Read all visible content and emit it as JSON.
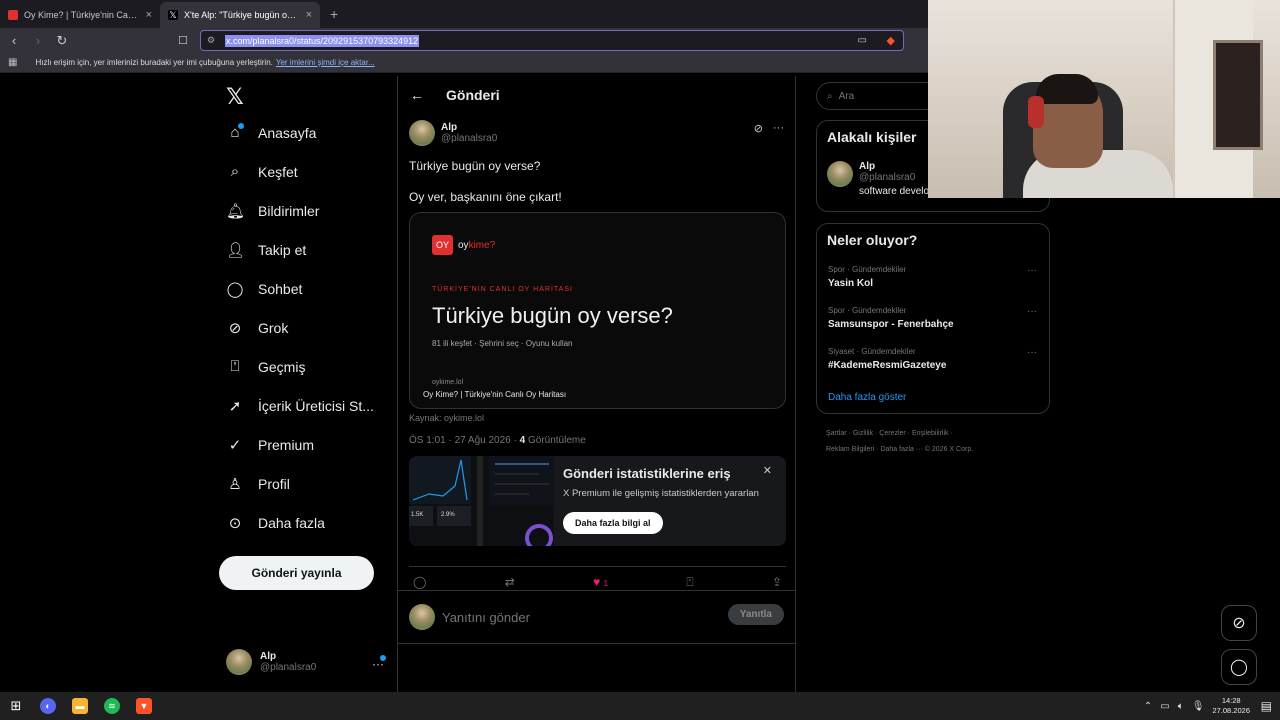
{
  "browser": {
    "tabs": [
      {
        "title": "Oy Kime? | Türkiye'nin Canlı Oy Haritası",
        "active": false
      },
      {
        "title": "X'te Alp: \"Türkiye bugün oy verse?\"",
        "active": true
      }
    ],
    "new_tab": "+",
    "url": "x.com/planalsra0/status/2092915370793324912",
    "bookmarks_bar_text": "Hızlı erişim için, yer imlerinizi buradaki yer imi çubuğuna yerleştirin.",
    "bookmarks_bar_link": "Yer imlerini şimdi içe aktar..."
  },
  "nav": {
    "items": [
      {
        "label": "Anasayfa",
        "icon": "home-icon"
      },
      {
        "label": "Keşfet",
        "icon": "search-icon"
      },
      {
        "label": "Bildirimler",
        "icon": "bell-icon"
      },
      {
        "label": "Takip et",
        "icon": "person-add-icon"
      },
      {
        "label": "Sohbet",
        "icon": "chat-icon"
      },
      {
        "label": "Grok",
        "icon": "grok-icon"
      },
      {
        "label": "Geçmiş",
        "icon": "bookmark-icon"
      },
      {
        "label": "İçerik Üreticisi St...",
        "icon": "rocket-icon"
      },
      {
        "label": "Premium",
        "icon": "verified-icon"
      },
      {
        "label": "Profil",
        "icon": "profile-icon"
      },
      {
        "label": "Daha fazla",
        "icon": "more-circle-icon"
      }
    ],
    "post_button": "Gönderi yayınla",
    "account": {
      "name": "Alp",
      "handle": "@planalsra0"
    }
  },
  "main": {
    "header": "Gönderi",
    "post": {
      "author": "Alp",
      "handle": "@planalsra0",
      "text1": "Türkiye bugün oy verse?",
      "text2": "Oy ver, başkanını öne çıkart!",
      "card": {
        "logo_box": "OY",
        "logo_oy": "oy",
        "logo_kime": "kime?",
        "eyebrow": "TÜRKİYE'NİN CANLI OY HARİTASI",
        "headline": "Türkiye bugün oy verse?",
        "sub": "81 ili keşfet · Şehrini seç · Oyunu kullan",
        "domain": "oykime.lol",
        "card_title": "Oy Kime? | Türkiye'nin Canlı Oy Haritası"
      },
      "source": "Kaynak: oykime.lol",
      "meta_time": "ÖS 1:01 · 27 Ağu 2026 · ",
      "views_count": "4",
      "views_label": " Görüntüleme",
      "promo": {
        "title": "Gönderi istatistiklerine eriş",
        "subtitle": "X Premium ile gelişmiş istatistiklerden yararlan",
        "button": "Daha fazla bilgi al",
        "stat1": "1.5K",
        "stat2": "2.9%"
      },
      "likes": "1"
    },
    "reply": {
      "placeholder": "Yanıtını gönder",
      "button": "Yanıtla"
    }
  },
  "right": {
    "search_placeholder": "Ara",
    "related_title": "Alakalı kişiler",
    "related": {
      "name": "Alp",
      "handle": "@planalsra0",
      "bio": "software developer,engineer"
    },
    "trends_title": "Neler oluyor?",
    "trends": [
      {
        "category": "Spor · Gündemdekiler",
        "title": "Yasin Kol"
      },
      {
        "category": "Spor · Gündemdekiler",
        "title": "Samsunspor - Fenerbahçe"
      },
      {
        "category": "Siyaset · Gündemdekiler",
        "title": "#KademeResmiGazeteye"
      }
    ],
    "show_more": "Daha fazla göster",
    "footer_line1": "Şartlar · Gizlilik · Çerezler · Erişilebilirlik ·",
    "footer_line2": "Reklam Bilgileri · Daha fazla ··· © 2026 X Corp."
  },
  "taskbar": {
    "time": "14:28",
    "date": "27.08.2026"
  },
  "colors": {
    "accent": "#1d9bf0",
    "like": "#f91880",
    "brand_red": "#e03030"
  }
}
